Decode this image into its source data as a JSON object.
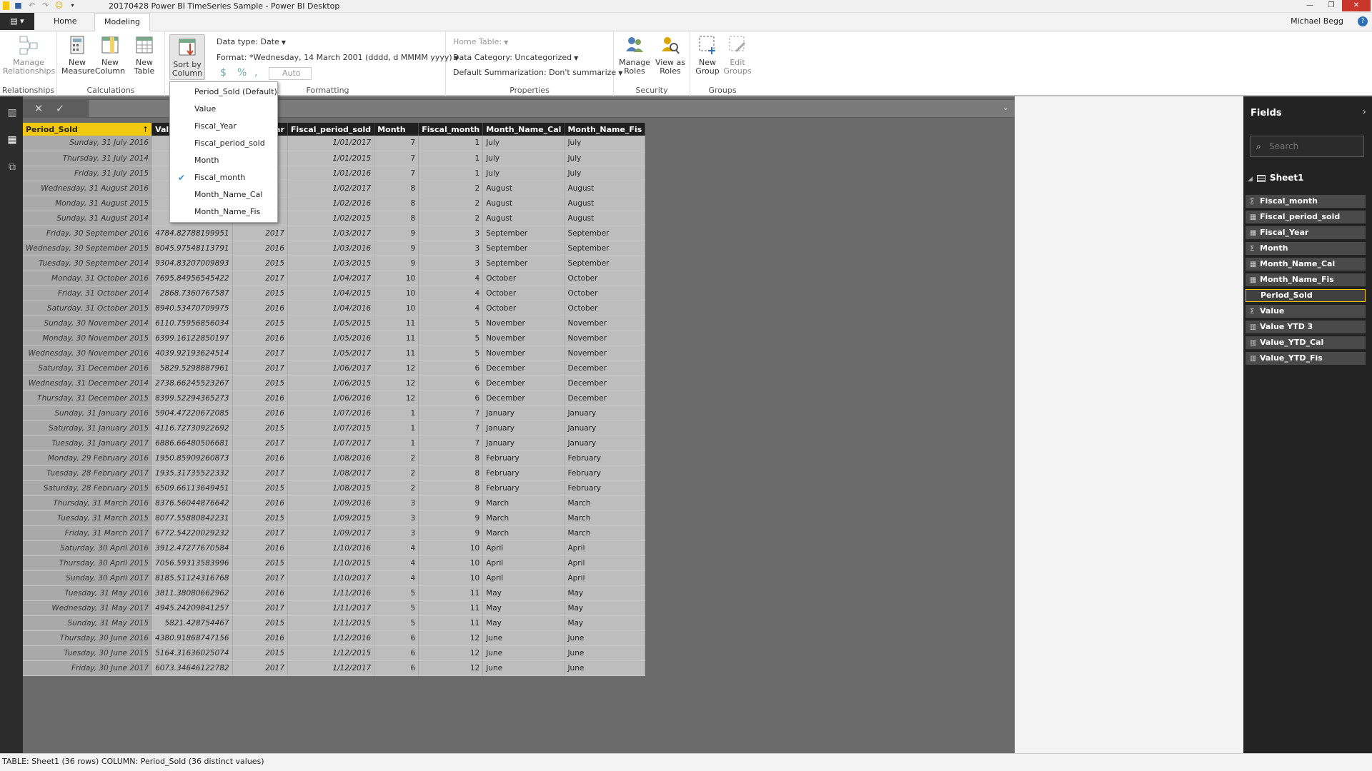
{
  "window": {
    "title": "20170428 Power BI TimeSeries Sample - Power BI Desktop",
    "minimize": "—",
    "restore": "❐",
    "close": "✕"
  },
  "qat": {
    "save_icon": "save-icon",
    "undo_icon": "undo-icon",
    "redo_icon": "redo-icon",
    "smiley_icon": "smiley-icon"
  },
  "tabs": {
    "file": "▤ ▾",
    "home": "Home",
    "modeling": "Modeling"
  },
  "user": {
    "name": "Michael Begg",
    "help": "?"
  },
  "ribbon": {
    "relationships": {
      "manage": "Manage Relationships",
      "group": "Relationships"
    },
    "calculations": {
      "new_measure": "New Measure",
      "new_column": "New Column",
      "new_table": "New Table",
      "group": "Calculations"
    },
    "sort": {
      "label": "Sort by Column"
    },
    "formatting": {
      "data_type": "Data type: Date",
      "format": "Format: *Wednesday, 14 March 2001 (dddd, d MMMM yyyy)",
      "currency": "$",
      "percent": "%",
      "comma": ",",
      "auto": "Auto",
      "group": "Formatting"
    },
    "properties": {
      "home_table": "Home Table:",
      "data_category": "Data Category: Uncategorized",
      "default_summarization": "Default Summarization: Don't summarize",
      "group": "Properties"
    },
    "security": {
      "manage_roles": "Manage Roles",
      "view_as_roles": "View as Roles",
      "group": "Security"
    },
    "groups": {
      "new_group": "New Group",
      "edit_groups": "Edit Groups",
      "group": "Groups"
    }
  },
  "sort_menu": {
    "items": [
      "Period_Sold (Default)",
      "Value",
      "Fiscal_Year",
      "Fiscal_period_sold",
      "Month",
      "Fiscal_month",
      "Month_Name_Cal",
      "Month_Name_Fis"
    ],
    "checked": "Fiscal_month"
  },
  "formula": {
    "cancel": "✕",
    "commit": "✓",
    "chevron": "⌄"
  },
  "table": {
    "columns": [
      "Period_Sold",
      "Value",
      "Fiscal_Year",
      "Fiscal_period_sold",
      "Month",
      "Fiscal_month",
      "Month_Name_Cal",
      "Month_Name_Fis"
    ],
    "sort_indicator": "↑",
    "rows": [
      [
        "Sunday, 31 July 2016",
        "8374.",
        "",
        "1/01/2017",
        "7",
        "1",
        "July",
        "July"
      ],
      [
        "Thursday, 31 July 2014",
        "5073.",
        "",
        "1/01/2015",
        "7",
        "1",
        "July",
        "July"
      ],
      [
        "Friday, 31 July 2015",
        "4520.",
        "",
        "1/01/2016",
        "7",
        "1",
        "July",
        "July"
      ],
      [
        "Wednesday, 31 August 2016",
        "768.8",
        "",
        "1/02/2017",
        "8",
        "2",
        "August",
        "August"
      ],
      [
        "Monday, 31 August 2015",
        "7111.",
        "",
        "1/02/2016",
        "8",
        "2",
        "August",
        "August"
      ],
      [
        "Sunday, 31 August 2014",
        "9091.",
        "",
        "1/02/2015",
        "8",
        "2",
        "August",
        "August"
      ],
      [
        "Friday, 30 September 2016",
        "4784.82788199951",
        "2017",
        "1/03/2017",
        "9",
        "3",
        "September",
        "September"
      ],
      [
        "Wednesday, 30 September 2015",
        "8045.97548113791",
        "2016",
        "1/03/2016",
        "9",
        "3",
        "September",
        "September"
      ],
      [
        "Tuesday, 30 September 2014",
        "9304.83207009893",
        "2015",
        "1/03/2015",
        "9",
        "3",
        "September",
        "September"
      ],
      [
        "Monday, 31 October 2016",
        "7695.84956545422",
        "2017",
        "1/04/2017",
        "10",
        "4",
        "October",
        "October"
      ],
      [
        "Friday, 31 October 2014",
        "2868.7360767587",
        "2015",
        "1/04/2015",
        "10",
        "4",
        "October",
        "October"
      ],
      [
        "Saturday, 31 October 2015",
        "8940.53470709975",
        "2016",
        "1/04/2016",
        "10",
        "4",
        "October",
        "October"
      ],
      [
        "Sunday, 30 November 2014",
        "6110.75956856034",
        "2015",
        "1/05/2015",
        "11",
        "5",
        "November",
        "November"
      ],
      [
        "Monday, 30 November 2015",
        "6399.16122850197",
        "2016",
        "1/05/2016",
        "11",
        "5",
        "November",
        "November"
      ],
      [
        "Wednesday, 30 November 2016",
        "4039.92193624514",
        "2017",
        "1/05/2017",
        "11",
        "5",
        "November",
        "November"
      ],
      [
        "Saturday, 31 December 2016",
        "5829.5298887961",
        "2017",
        "1/06/2017",
        "12",
        "6",
        "December",
        "December"
      ],
      [
        "Wednesday, 31 December 2014",
        "2738.66245523267",
        "2015",
        "1/06/2015",
        "12",
        "6",
        "December",
        "December"
      ],
      [
        "Thursday, 31 December 2015",
        "8399.52294365273",
        "2016",
        "1/06/2016",
        "12",
        "6",
        "December",
        "December"
      ],
      [
        "Sunday, 31 January 2016",
        "5904.47220672085",
        "2016",
        "1/07/2016",
        "1",
        "7",
        "January",
        "January"
      ],
      [
        "Saturday, 31 January 2015",
        "4116.72730922692",
        "2015",
        "1/07/2015",
        "1",
        "7",
        "January",
        "January"
      ],
      [
        "Tuesday, 31 January 2017",
        "6886.66480506681",
        "2017",
        "1/07/2017",
        "1",
        "7",
        "January",
        "January"
      ],
      [
        "Monday, 29 February 2016",
        "1950.85909260873",
        "2016",
        "1/08/2016",
        "2",
        "8",
        "February",
        "February"
      ],
      [
        "Tuesday, 28 February 2017",
        "1935.31735522332",
        "2017",
        "1/08/2017",
        "2",
        "8",
        "February",
        "February"
      ],
      [
        "Saturday, 28 February 2015",
        "6509.66113649451",
        "2015",
        "1/08/2015",
        "2",
        "8",
        "February",
        "February"
      ],
      [
        "Thursday, 31 March 2016",
        "8376.56044876642",
        "2016",
        "1/09/2016",
        "3",
        "9",
        "March",
        "March"
      ],
      [
        "Tuesday, 31 March 2015",
        "8077.55880842231",
        "2015",
        "1/09/2015",
        "3",
        "9",
        "March",
        "March"
      ],
      [
        "Friday, 31 March 2017",
        "6772.54220029232",
        "2017",
        "1/09/2017",
        "3",
        "9",
        "March",
        "March"
      ],
      [
        "Saturday, 30 April 2016",
        "3912.47277670584",
        "2016",
        "1/10/2016",
        "4",
        "10",
        "April",
        "April"
      ],
      [
        "Thursday, 30 April 2015",
        "7056.59313583996",
        "2015",
        "1/10/2015",
        "4",
        "10",
        "April",
        "April"
      ],
      [
        "Sunday, 30 April 2017",
        "8185.51124316768",
        "2017",
        "1/10/2017",
        "4",
        "10",
        "April",
        "April"
      ],
      [
        "Tuesday, 31 May 2016",
        "3811.38080662962",
        "2016",
        "1/11/2016",
        "5",
        "11",
        "May",
        "May"
      ],
      [
        "Wednesday, 31 May 2017",
        "4945.24209841257",
        "2017",
        "1/11/2017",
        "5",
        "11",
        "May",
        "May"
      ],
      [
        "Sunday, 31 May 2015",
        "5821.428754467",
        "2015",
        "1/11/2015",
        "5",
        "11",
        "May",
        "May"
      ],
      [
        "Thursday, 30 June 2016",
        "4380.91868747156",
        "2016",
        "1/12/2016",
        "6",
        "12",
        "June",
        "June"
      ],
      [
        "Tuesday, 30 June 2015",
        "5164.31636025074",
        "2015",
        "1/12/2015",
        "6",
        "12",
        "June",
        "June"
      ],
      [
        "Friday, 30 June 2017",
        "6073.34646122782",
        "2017",
        "1/12/2017",
        "6",
        "12",
        "June",
        "June"
      ]
    ]
  },
  "fields": {
    "title": "Fields",
    "search_placeholder": "Search",
    "table_name": "Sheet1",
    "items": [
      {
        "name": "Fiscal_month",
        "icon": "Σ"
      },
      {
        "name": "Fiscal_period_sold",
        "icon": "▦"
      },
      {
        "name": "Fiscal_Year",
        "icon": "▦"
      },
      {
        "name": "Month",
        "icon": "Σ"
      },
      {
        "name": "Month_Name_Cal",
        "icon": "▦"
      },
      {
        "name": "Month_Name_Fis",
        "icon": "▦"
      },
      {
        "name": "Period_Sold",
        "icon": ""
      },
      {
        "name": "Value",
        "icon": "Σ"
      },
      {
        "name": "Value YTD 3",
        "icon": "▥"
      },
      {
        "name": "Value_YTD_Cal",
        "icon": "▥"
      },
      {
        "name": "Value_YTD_Fis",
        "icon": "▥"
      }
    ],
    "selected": "Period_Sold"
  },
  "status": {
    "text": "TABLE: Sheet1 (36 rows) COLUMN: Period_Sold (36 distinct values)"
  },
  "colors": {
    "accent": "#f2c811",
    "rail": "#2c2c2c",
    "canvas": "#6b6b6b",
    "check": "#3a8dd6"
  }
}
